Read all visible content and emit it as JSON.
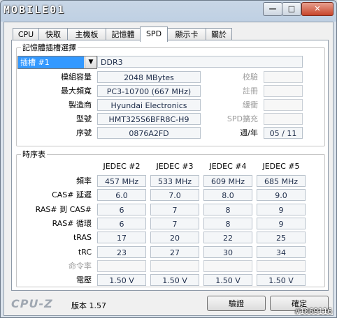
{
  "titlebar": {
    "logo_text": "MOBILE01",
    "minimize": "—",
    "maximize": "□",
    "close": "✕"
  },
  "tabs": [
    "CPU",
    "快取",
    "主機板",
    "記憶體",
    "SPD",
    "顯示卡",
    "關於"
  ],
  "active_tab": "SPD",
  "slot_section": {
    "legend": "記憶體插槽選擇",
    "slot_value": "插槽 #1",
    "memory_type": "DDR3",
    "rows": [
      {
        "label": "模組容量",
        "value": "2048 MBytes",
        "right_label": "校驗"
      },
      {
        "label": "最大頻寬",
        "value": "PC3-10700 (667 MHz)",
        "right_label": "註冊"
      },
      {
        "label": "製造商",
        "value": "Hyundai Electronics",
        "right_label": "緩衝"
      },
      {
        "label": "型號",
        "value": "HMT325S6BFR8C-H9",
        "right_label": "SPD擴充"
      },
      {
        "label": "序號",
        "value": "0876A2FD",
        "right_label": "週/年",
        "right_value": "05 / 11"
      }
    ]
  },
  "timing_section": {
    "legend": "時序表",
    "columns": [
      "JEDEC #2",
      "JEDEC #3",
      "JEDEC #4",
      "JEDEC #5"
    ],
    "rows": [
      {
        "label": "頻率",
        "values": [
          "457 MHz",
          "533 MHz",
          "609 MHz",
          "685 MHz"
        ]
      },
      {
        "label": "CAS# 延遲",
        "values": [
          "6.0",
          "7.0",
          "8.0",
          "9.0"
        ]
      },
      {
        "label": "RAS# 到 CAS#",
        "values": [
          "6",
          "7",
          "8",
          "9"
        ]
      },
      {
        "label": "RAS# 循環",
        "values": [
          "6",
          "7",
          "8",
          "9"
        ]
      },
      {
        "label": "tRAS",
        "values": [
          "17",
          "20",
          "22",
          "25"
        ]
      },
      {
        "label": "tRC",
        "values": [
          "23",
          "27",
          "30",
          "34"
        ]
      },
      {
        "label": "命令率",
        "values": [
          "",
          "",
          "",
          ""
        ],
        "dim": true
      },
      {
        "label": "電壓",
        "values": [
          "1.50 V",
          "1.50 V",
          "1.50 V",
          "1.50 V"
        ]
      }
    ]
  },
  "footer": {
    "brand": "CPU-Z",
    "version": "版本 1.57",
    "validate_button": "驗證",
    "ok_button": "確定",
    "watermark": "#1069116"
  }
}
